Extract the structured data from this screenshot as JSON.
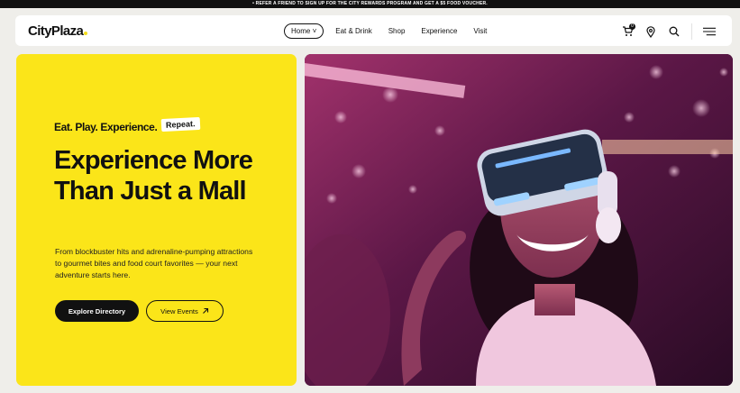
{
  "promo": {
    "text": "• REFER A FRIEND TO SIGN UP FOR THE CITY REWARDS PROGRAM AND GET A $5 FOOD VOUCHER."
  },
  "brand": {
    "name": "CityPlaza",
    "accent": "#f4dd1c"
  },
  "nav": {
    "items": [
      {
        "label": "Home ˅",
        "active": true
      },
      {
        "label": "Eat & Drink"
      },
      {
        "label": "Shop"
      },
      {
        "label": "Experience"
      },
      {
        "label": "Visit"
      }
    ],
    "cart_count": "0",
    "icons": [
      "cart-icon",
      "location-pin-icon",
      "search-icon",
      "hamburger-menu-icon"
    ]
  },
  "hero": {
    "tagline": "Eat. Play. Experience.",
    "badge": "Repeat.",
    "headline": "Experience More Than Just a Mall",
    "description": "From blockbuster hits and adrenaline-pumping attractions to gourmet bites and food court favorites — your next adventure starts here.",
    "primary_button": "Explore Directory",
    "secondary_button": "View Events",
    "background_color": "#fbe519",
    "image_alt": "woman wearing VR headset laughing"
  }
}
